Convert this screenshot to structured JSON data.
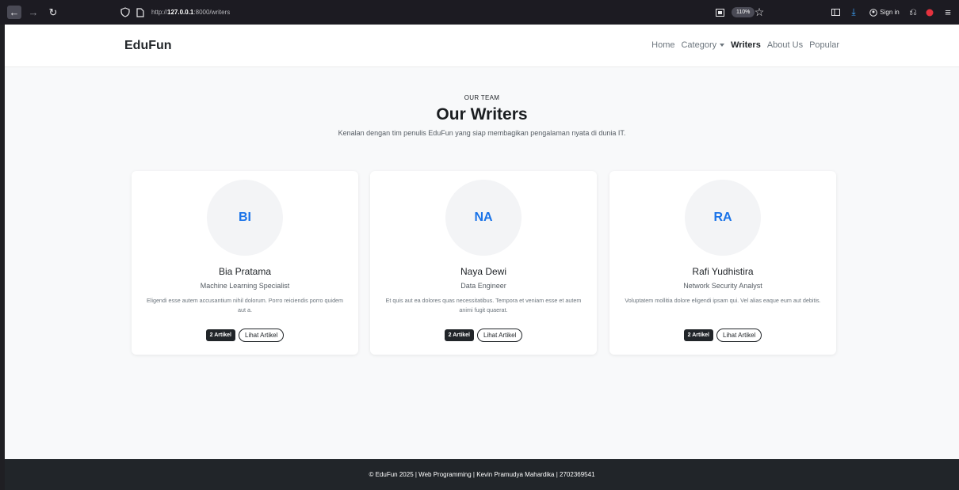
{
  "browser": {
    "url_prefix": "http://",
    "url_host": "127.0.0.1",
    "url_path": ":8000/writers",
    "zoom": "110%",
    "signin_label": "Sign in"
  },
  "navbar": {
    "brand": "EduFun",
    "links": [
      {
        "label": "Home"
      },
      {
        "label": "Category"
      },
      {
        "label": "Writers"
      },
      {
        "label": "About Us"
      },
      {
        "label": "Popular"
      }
    ]
  },
  "header": {
    "eyebrow": "OUR TEAM",
    "title": "Our Writers",
    "subtitle": "Kenalan dengan tim penulis EduFun yang siap membagikan pengalaman nyata di dunia IT."
  },
  "writers": [
    {
      "initials": "BI",
      "name": "Bia Pratama",
      "role": "Machine Learning Specialist",
      "bio": "Eligendi esse autem accusantium nihil dolorum. Porro reiciendis porro quidem aut a.",
      "article_count": "2 Artikel",
      "button": "Lihat Artikel"
    },
    {
      "initials": "NA",
      "name": "Naya Dewi",
      "role": "Data Engineer",
      "bio": "Et quis aut ea dolores quas necessitatibus. Tempora et veniam esse et autem animi fugit quaerat.",
      "article_count": "2 Artikel",
      "button": "Lihat Artikel"
    },
    {
      "initials": "RA",
      "name": "Rafi Yudhistira",
      "role": "Network Security Analyst",
      "bio": "Voluptatem mollitia dolore eligendi ipsam qui. Vel alias eaque eum aut debitis.",
      "article_count": "2 Artikel",
      "button": "Lihat Artikel"
    }
  ],
  "footer": {
    "text": "© EduFun 2025 | Web Programming | Kevin Pramudya Mahardika | 2702369541"
  },
  "colors": {
    "initials": "#1a73e8",
    "footer_bg": "#212529",
    "page_bg": "#f8f9fa"
  }
}
